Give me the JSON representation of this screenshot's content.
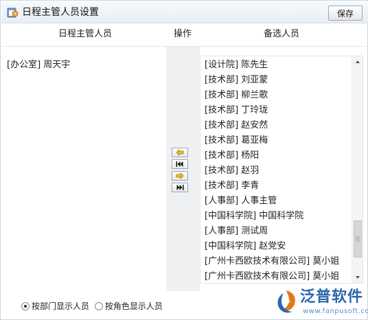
{
  "window": {
    "title": "日程主管人员设置",
    "save_label": "保存"
  },
  "headers": {
    "selected": "日程主管人员",
    "actions": "操作",
    "candidates": "备选人员"
  },
  "selected_people": [
    "[办公室] 周天宇"
  ],
  "candidate_people": [
    "[设计院] 陈先生",
    "[技术部] 刘亚蒙",
    "[技术部] 柳兰歌",
    "[技术部] 丁玲珑",
    "[技术部] 赵安然",
    "[技术部] 葛亚梅",
    "[技术部] 杨阳",
    "[技术部] 赵羽",
    "[技术部] 李青",
    "[人事部] 人事主管",
    "[中国科学院] 中国科学院",
    "[人事部] 测试周",
    "[中国科学院] 赵党安",
    "[广州卡西欧技术有限公司] 莫小姐",
    "[广州卡西欧技术有限公司] 莫小姐"
  ],
  "actions": [
    {
      "name": "move-one-left-button",
      "icon": "arrow-left-icon"
    },
    {
      "name": "move-all-left-button",
      "icon": "double-left-icon"
    },
    {
      "name": "move-one-right-button",
      "icon": "arrow-right-icon"
    },
    {
      "name": "move-all-right-button",
      "icon": "double-right-icon"
    }
  ],
  "display_mode": {
    "by_department": "按部门显示人员",
    "by_role": "按角色显示人员",
    "selected": "by_department"
  },
  "brand": {
    "name": "泛普软件",
    "url": "www.fanpusoft.com",
    "color": "#2a66b0"
  },
  "colors": {
    "action_arrow": "#e0b400",
    "panel_gray": "#eef0f2"
  }
}
